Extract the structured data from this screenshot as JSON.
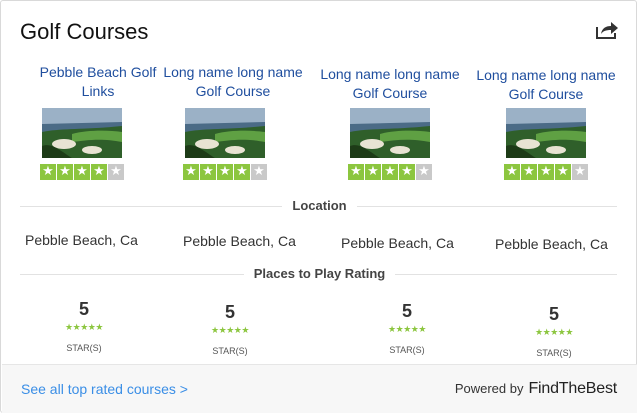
{
  "widget": {
    "title": "Golf Courses",
    "share_icon": "share-icon"
  },
  "courses": [
    {
      "name": "Pebble Beach Golf Links",
      "rating_stars": 4,
      "location": "Pebble Beach, Ca",
      "play_rating": "5",
      "play_unit": "STAR(S)"
    },
    {
      "name": "Long name long name Golf Course",
      "rating_stars": 4,
      "location": "Pebble Beach, Ca",
      "play_rating": "5",
      "play_unit": "STAR(S)"
    },
    {
      "name": "Long name long name Golf Course",
      "rating_stars": 4,
      "location": "Pebble Beach, Ca",
      "play_rating": "5",
      "play_unit": "STAR(S)"
    },
    {
      "name": "Long name long name Golf Course",
      "rating_stars": 4,
      "location": "Pebble Beach, Ca",
      "play_rating": "5",
      "play_unit": "STAR(S)"
    }
  ],
  "sections": {
    "location": "Location",
    "play_rating": "Places to Play Rating"
  },
  "footer": {
    "see_all": "See all top rated courses >",
    "powered_by": "Powered by",
    "brand": "FindTheBest"
  },
  "colors": {
    "link": "#1f4e9e",
    "star_on": "#8cc63f",
    "star_off": "#c9c9c9",
    "footer_link": "#3a8ee6"
  }
}
